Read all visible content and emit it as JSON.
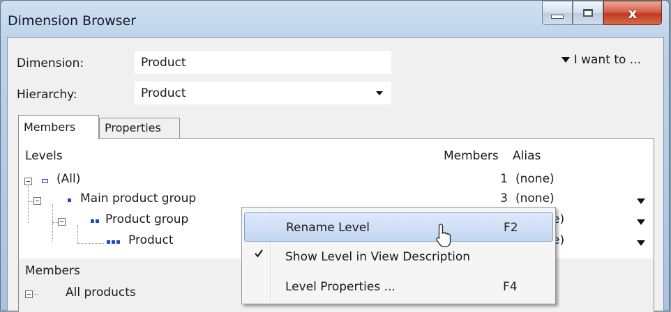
{
  "window": {
    "title": "Dimension Browser",
    "controls": {
      "minimize": "minimize",
      "maximize": "maximize",
      "close": "x"
    }
  },
  "form": {
    "dimension_label": "Dimension:",
    "dimension_value": "Product",
    "hierarchy_label": "Hierarchy:",
    "hierarchy_value": "Product",
    "i_want_to": "I want to ..."
  },
  "tabs": [
    {
      "label": "Members",
      "active": true
    },
    {
      "label": "Properties",
      "active": false
    }
  ],
  "levels_table": {
    "header_levels": "Levels",
    "header_members": "Members",
    "header_alias": "Alias",
    "rows": [
      {
        "name": "(All)",
        "members": "1",
        "alias": "(none)"
      },
      {
        "name": "Main product group",
        "members": "3",
        "alias": "(none)"
      },
      {
        "name": "Product group",
        "members": "",
        "alias": "e)"
      },
      {
        "name": "Product",
        "members": "",
        "alias": "e)"
      }
    ]
  },
  "members_section": {
    "header": "Members",
    "items": [
      {
        "label": "All products"
      }
    ]
  },
  "context_menu": {
    "items": [
      {
        "label": "Rename Level",
        "shortcut": "F2",
        "highlighted": true,
        "checked": false
      },
      {
        "label": "Show Level in View Description",
        "shortcut": "",
        "highlighted": false,
        "checked": true
      },
      {
        "label": "Level Properties ...",
        "shortcut": "F4",
        "highlighted": false,
        "checked": false
      }
    ]
  },
  "icons": {
    "close": "close-icon",
    "dropdown": "chevron-down-icon",
    "check": "checkmark-icon",
    "cursor": "mouse-pointer-icon"
  },
  "colors": {
    "highlight": "#c3d7f2",
    "level_icon": "#2244cc",
    "close_button": "#c2391e"
  }
}
